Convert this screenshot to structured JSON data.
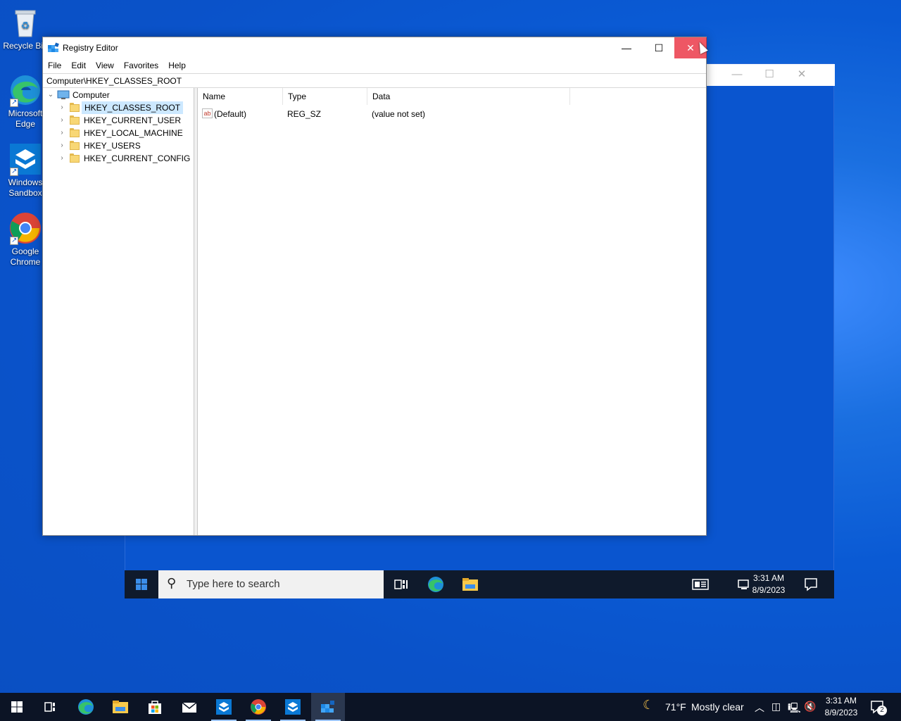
{
  "desktop": {
    "icons": [
      {
        "name": "recycle-bin",
        "label": "Recycle Bin"
      },
      {
        "name": "microsoft-edge",
        "label": "Microsoft\nEdge"
      },
      {
        "name": "windows-sandbox",
        "label": "Windows\nSandbox"
      },
      {
        "name": "google-chrome",
        "label": "Google\nChrome"
      }
    ]
  },
  "regedit": {
    "title": "Registry Editor",
    "menu": [
      "File",
      "Edit",
      "View",
      "Favorites",
      "Help"
    ],
    "address": "Computer\\HKEY_CLASSES_ROOT",
    "tree": {
      "root": "Computer",
      "children": [
        "HKEY_CLASSES_ROOT",
        "HKEY_CURRENT_USER",
        "HKEY_LOCAL_MACHINE",
        "HKEY_USERS",
        "HKEY_CURRENT_CONFIG"
      ],
      "selected": "HKEY_CLASSES_ROOT"
    },
    "columns": [
      "Name",
      "Type",
      "Data"
    ],
    "values": [
      {
        "name": "(Default)",
        "type": "REG_SZ",
        "data": "(value not set)",
        "icon": "ab"
      }
    ]
  },
  "vm": {
    "search_placeholder": "Type here to search",
    "clock": {
      "time": "3:31 AM",
      "date": "8/9/2023"
    }
  },
  "taskbar": {
    "weather": {
      "temp": "71°F",
      "condition": "Mostly clear"
    },
    "clock": {
      "time": "3:31 AM",
      "date": "8/9/2023"
    },
    "notifications": "2"
  },
  "colors": {
    "accent": "#0078d7",
    "selection": "#cce8ff",
    "close_hover": "#e81123",
    "taskbar": "#0c1425"
  }
}
